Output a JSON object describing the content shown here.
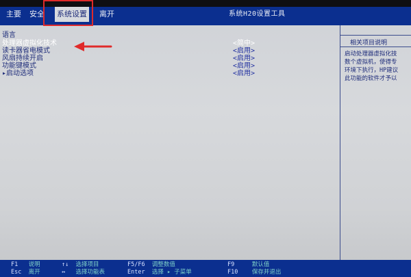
{
  "menu": {
    "tabs": [
      "主要",
      "安全",
      "系统设置",
      "离开"
    ],
    "active_tab": "系统设置",
    "title": "系统H20设置工具"
  },
  "settings": [
    {
      "label": "语言",
      "value": ""
    },
    {
      "label": "处理器虚拟化技术",
      "value": "<简中>",
      "selected": true
    },
    {
      "label": "读卡器省电模式",
      "value": "<启用>"
    },
    {
      "label": "风扇持续开启",
      "value": "<启用>"
    },
    {
      "label": "功能键模式",
      "value": "<启用>"
    },
    {
      "label": "▸启动选项",
      "value": "<启用>"
    }
  ],
  "help": {
    "title": "相关项目说明",
    "lines": [
      "启动处理器虚拟化技",
      "数个虚拟机，使得专",
      "环境下执行，HP建议",
      "此功能的软件才予以"
    ]
  },
  "footer": {
    "keys": [
      {
        "key": "F1",
        "desc": "说明"
      },
      {
        "key": "Esc",
        "desc": "离开"
      },
      {
        "key": "↑↓",
        "desc": "选择项目"
      },
      {
        "key": "↔",
        "desc": "选择功能表"
      },
      {
        "key": "F5/F6",
        "desc": "调整数值"
      },
      {
        "key": "Enter",
        "desc": "选择 ▸ 子菜单"
      },
      {
        "key": "F9",
        "desc": "默认值"
      },
      {
        "key": "F10",
        "desc": "保存并退出"
      }
    ]
  },
  "colors": {
    "bios_blue": "#0b2f8f",
    "screen_gray": "#d4d6d9",
    "annotation_red": "#e02a2a"
  }
}
